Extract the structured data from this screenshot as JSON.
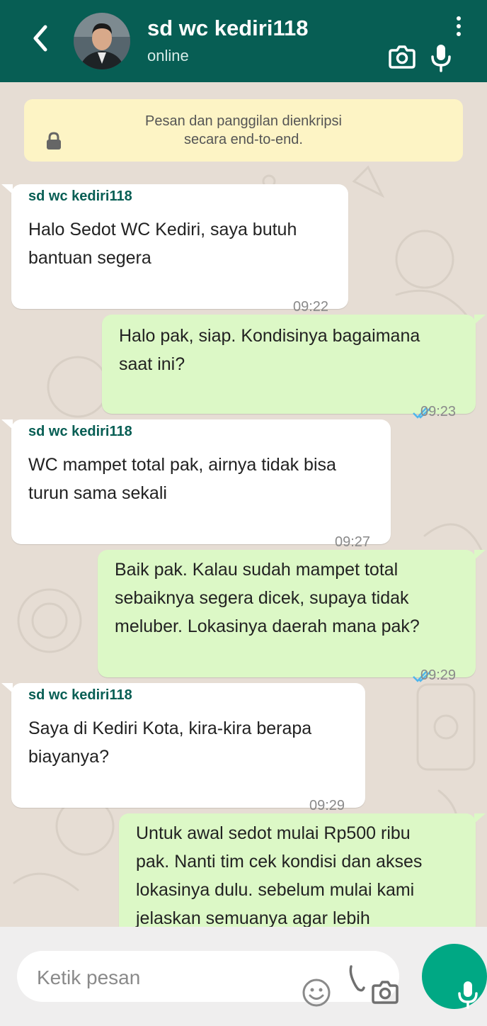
{
  "header": {
    "contact_name": "sd wc kediri118",
    "status": "online",
    "back_icon": "chevron-left-icon",
    "menu_icon": "more-vertical-icon",
    "camera_icon": "camera-icon",
    "mic_icon": "mic-icon",
    "color": "#075e54"
  },
  "notice": {
    "line1": "Pesan dan panggilan dienkripsi",
    "line2": "secara end-to-end.",
    "icon": "lock-icon"
  },
  "messages": [
    {
      "direction": "in",
      "sender": "sd wc kediri118",
      "lines": [
        "Halo Sedot WC Kediri, saya butuh",
        "bantuan segera"
      ],
      "time": "09:22"
    },
    {
      "direction": "out",
      "lines": [
        "Halo pak, siap. Kondisinya bagaimana",
        "saat ini?"
      ],
      "time": "09:23",
      "status": "read"
    },
    {
      "direction": "in",
      "sender": "sd wc kediri118",
      "lines": [
        "WC mampet total pak, airnya tidak bisa",
        "turun sama sekali"
      ],
      "time": "09:27"
    },
    {
      "direction": "out",
      "lines": [
        "Baik pak. Kalau sudah mampet total",
        "sebaiknya segera dicek, supaya tidak",
        "meluber. Lokasinya daerah mana pak?"
      ],
      "time": "09:29",
      "status": "read"
    },
    {
      "direction": "in",
      "sender": "sd wc kediri118",
      "lines": [
        "Saya di Kediri Kota, kira-kira berapa",
        "biayanya?"
      ],
      "time": "09:29"
    },
    {
      "direction": "out",
      "lines": [
        "Untuk awal sedot mulai Rp500 ribu",
        "pak. Nanti tim cek kondisi dan akses",
        "lokasinya dulu. sebelum mulai kami",
        "jelaskan semuanya agar lebih"
      ]
    }
  ],
  "composer": {
    "placeholder": "Ketik pesan",
    "emoji_icon": "emoji-icon",
    "attach_icon": "paperclip-icon",
    "camera_icon": "camera-icon",
    "send_icon": "mic-icon",
    "fab_color": "#00a884"
  },
  "colors": {
    "incoming_bubble": "#ffffff",
    "outgoing_bubble": "#dcf8c6",
    "sender_name": "#075e54",
    "read_ticks": "#4fb6ec",
    "chat_background": "#e6ddd4"
  }
}
